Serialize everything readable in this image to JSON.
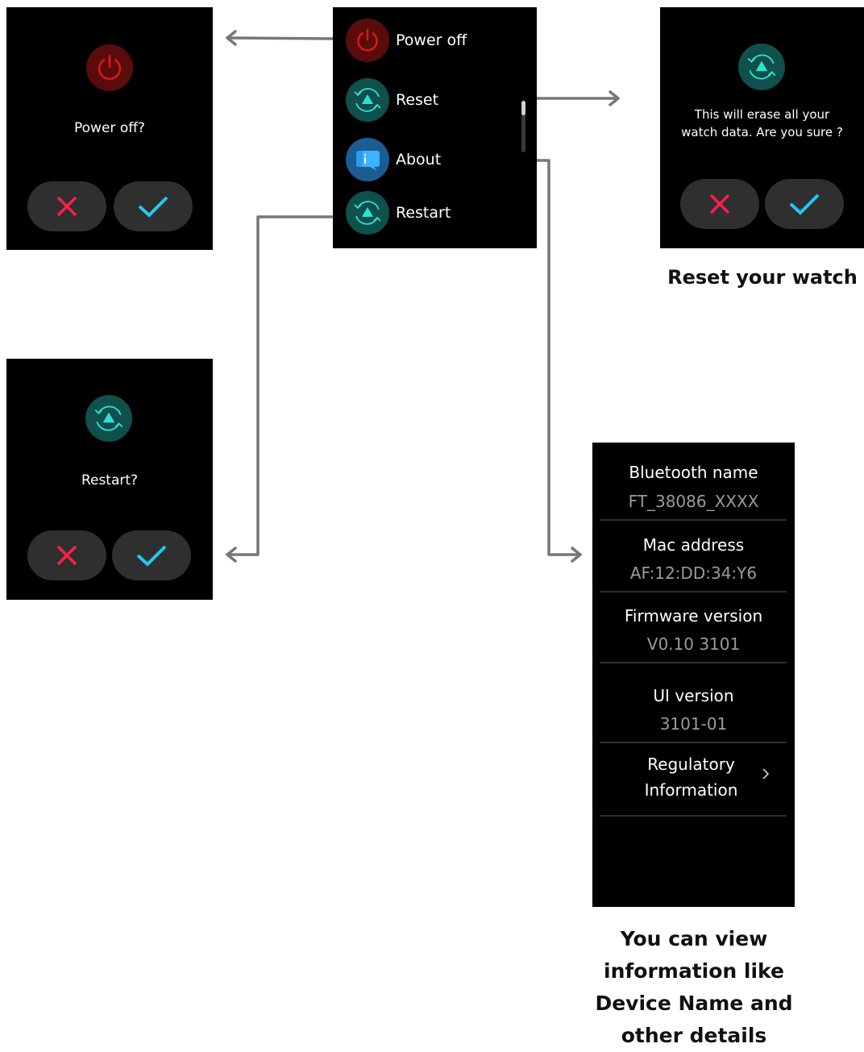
{
  "menu": {
    "items": [
      {
        "label": "Power off",
        "icon": "power-icon"
      },
      {
        "label": "Reset",
        "icon": "reset-icon"
      },
      {
        "label": "About",
        "icon": "info-icon"
      },
      {
        "label": "Restart",
        "icon": "restart-icon"
      }
    ]
  },
  "power_dialog": {
    "title": "Power off?",
    "cancel_icon": "cross-icon",
    "confirm_icon": "check-icon"
  },
  "reset_dialog": {
    "message": "This will erase all your watch data. Are you sure ?",
    "cancel_icon": "cross-icon",
    "confirm_icon": "check-icon"
  },
  "restart_dialog": {
    "title": "Restart?",
    "cancel_icon": "cross-icon",
    "confirm_icon": "check-icon"
  },
  "about": {
    "rows": [
      {
        "label": "Bluetooth name",
        "value": "FT_38086_XXXX"
      },
      {
        "label": "Mac address",
        "value": "AF:12:DD:34:Y6"
      },
      {
        "label": "Firmware version",
        "value": "V0.10 3101"
      },
      {
        "label": "UI version",
        "value": "3101-01"
      }
    ],
    "regulatory_line1": "Regulatory",
    "regulatory_line2": "Information"
  },
  "captions": {
    "reset": "Reset your watch",
    "about_1": "You can view",
    "about_2": "information like",
    "about_3": "Device Name and",
    "about_4": "other details"
  },
  "colors": {
    "screen_bg": "#000000",
    "power_red": "#d3191c",
    "power_bg": "#5a0c0c",
    "teal_bg": "#0f4f4c",
    "teal": "#2fe0d0",
    "info_blue": "#1e88d6",
    "cancel_red": "#ff1f4b",
    "confirm_cyan": "#22c8f0",
    "connector": "#777777"
  }
}
